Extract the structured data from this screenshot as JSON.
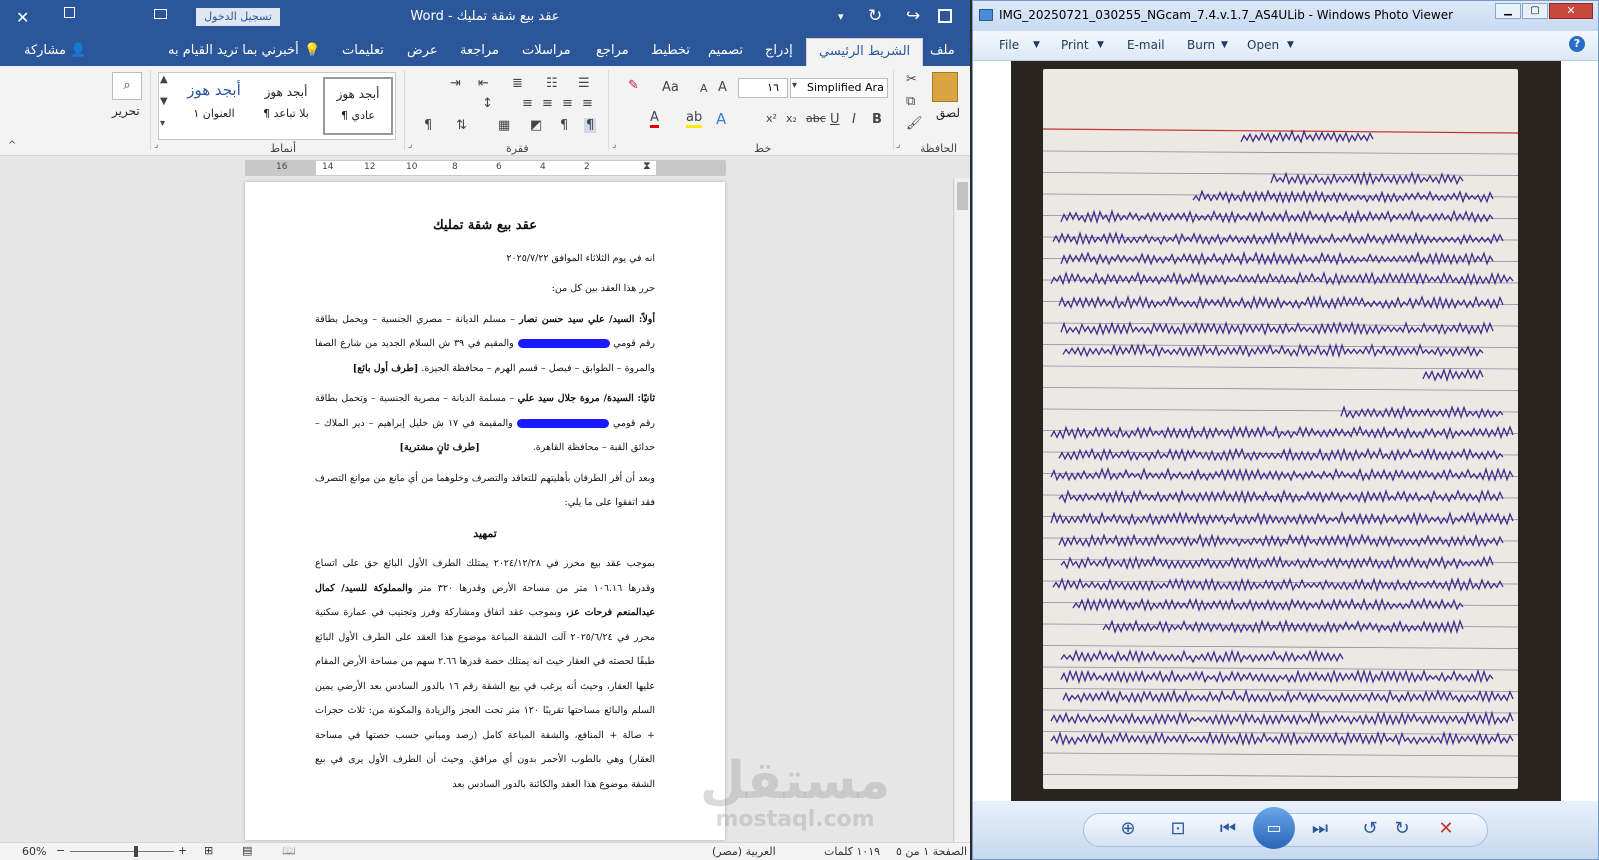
{
  "word": {
    "title": "عقد بيع شقة تمليك  -  Word",
    "signin_label": "تسجيل الدخول",
    "tabs": [
      "ملف",
      "الشريط الرئيسي",
      "إدراج",
      "تصميم",
      "تخطيط",
      "مراجع",
      "مراسلات",
      "مراجعة",
      "عرض",
      "تعليمات"
    ],
    "tell_me": "أخبرني بما تريد القيام به",
    "share": "مشاركة",
    "ribbon": {
      "paste": "لصق",
      "clipboard_group": "الحافظة",
      "font_name": "Simplified Ara",
      "font_size": "١٦",
      "font_group": "خط",
      "paragraph_group": "فقرة",
      "styles_group": "أنماط",
      "editing": "تحرير",
      "styles": [
        {
          "sample": "أبجد هوز",
          "name": "¶ عادي"
        },
        {
          "sample": "أبجد هوز",
          "name": "¶ بلا تباعد"
        },
        {
          "sample": "أبجد هوز",
          "name": "العنوان ١"
        }
      ]
    },
    "ruler_marks": [
      "16",
      "14",
      "12",
      "10",
      "8",
      "6",
      "4",
      "2"
    ],
    "document": {
      "title": "عقد بيع شقة تمليك",
      "date_line": "انه في يوم الثلاثاء الموافق ٢٠٢٥/٧/٢٢",
      "intro": "حرر هذا العقد بين كل من:",
      "party1_lead": "أولاً: السيد/ علي سيد حسن نصار",
      "party1_text": "– مسلم الديانة – مصري الجنسية – ويحمل بطاقة رقم قومي",
      "party1_address": "والمقيم في ٣٩ ش السلام الجديد من شارع الصفا والمروة – الطوابق – فيصل – قسم الهرم – محافظة الجيزة.",
      "party1_tag": "[طرف أول بائع]",
      "party2_lead": "ثانيًا: السيدة/ مروة جلال سيد علي",
      "party2_text": "– مسلمة الديانة – مصرية الجنسية – وتحمل بطاقة رقم قومي",
      "party2_address": "والمقيمة في ١٧ ش خليل إبراهيم – دير الملاك – حدائق القبة – محافظة القاهرة.",
      "party2_tag": "[طرف ثانٍ مشترية]",
      "capacity": "وبعد أن أقر الطرفان بأهليتهم للتعاقد والتصرف وخلوهما من أي مانع من موانع التصرف فقد اتفقوا على ما يلي:",
      "preamble_title": "تمهيد",
      "preamble_1": "بموجب عقد بيع محرر في ٢٠٢٤/١٢/٢٨ يمتلك الطرف الأول البائع حق على اتساع وقدرها ١٠٦.١٦ متر من مساحة الأرض وقدرها ٣٢٠ متر",
      "preamble_bold": "والمملوكة للسيد/ كمال عبدالمنعم فرحات عز،",
      "preamble_2": "وبموجب عقد اتفاق ومشاركة وفرز وتجنيب في عمارة سكنية محرر في ٢٠٢٥/٦/٢٤ آلت الشقة المباعة موضوع هذا العقد على الطرف الأول البائع طبقًا لحصته في العقار حيث انه يمتلك حصة قدرها ٢.٦٦ سهم من مساحة الأرض المقام عليها العقار، وحيث أنه يرغب في بيع الشقة رقم ١٦ بالدور السادس بعد الأرضي يمين السلم والبائع مساحتها تقريبًا ١٢٠ متر تحت العجز والزيادة والمكونة من: ثلاث حجرات + صالة + المنافع، والشقة المباعة كامل (رصد ومباني حسب حصتها في مساحة العقار) وهي بالطوب الأحمر بدون أي مرافق. وحيث أن الطرف الأول يرى في بيع الشقة موضوع هذا العقد والكائنة بالدور السادس بعد"
    },
    "status": {
      "page": "الصفحة ١ من ٥",
      "words": "١٠١٩ كلمات",
      "language": "العربية (مصر)",
      "zoom": "60%"
    },
    "watermark": {
      "arabic": "مستقل",
      "latin": "mostaql.com"
    }
  },
  "viewer": {
    "title": "IMG_20250721_030255_NGcam_7.4.v.1.7_AS4ULib - Windows Photo Viewer",
    "menu": [
      "File",
      "Print",
      "E-mail",
      "Burn",
      "Open"
    ],
    "photo_colors": {
      "paper": "#ece8e4",
      "ink": "#3a2f8a",
      "line": "#8a8a9a",
      "margin": "#c0392b"
    }
  }
}
